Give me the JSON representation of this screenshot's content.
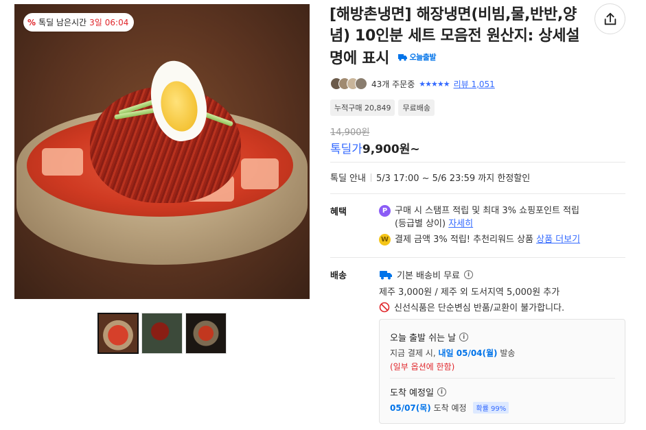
{
  "gallery": {
    "timer": {
      "label": "톡딜 남은시간",
      "days": "3일",
      "clock": "06:04"
    },
    "thumbnails": [
      "bibim-naengmyeon-bowl",
      "noodles-closeup",
      "naengmyeon-dark-bowl"
    ]
  },
  "product": {
    "title": "[해방촌냉면] 해장냉면(비빔,물,반반,양념) 10인분 세트 모음전 원산지: 상세설명에 표시",
    "today_badge": "오늘출발",
    "order_count": "43개 주문중",
    "stars": "★★★★★",
    "review_link": "리뷰 1,051",
    "tags": [
      "누적구매 20,849",
      "무료배송"
    ],
    "original_price": "14,900원",
    "sale_label": "톡딜가",
    "sale_price": "9,900원~"
  },
  "deal": {
    "label": "톡딜 안내",
    "period": "5/3 17:00 ~ 5/6 23:59 까지 한정할인"
  },
  "benefit": {
    "label": "혜택",
    "items": [
      {
        "text": "구매 시 스탬프 적립 및 최대 3% 쇼핑포인트 적립",
        "sub": "(등급별 상이)",
        "link": "자세히",
        "icon": "point-icon",
        "icon_glyph": "P",
        "color": "#8b5cf6"
      },
      {
        "text": "결제 금액 3% 적립! 추천리워드 상품",
        "link": "상품 더보기",
        "icon": "reward-coin-icon",
        "icon_glyph": "W",
        "color": "#f5c518"
      }
    ]
  },
  "shipping": {
    "label": "배송",
    "fee": "기본 배송비 무료",
    "extra": "제주 3,000원 / 제주 외 도서지역 5,000원 추가",
    "notice": "신선식품은 단순변심 반품/교환이 불가합니다.",
    "box": {
      "holiday_title": "오늘 출발 쉬는 날",
      "pay_prefix": "지금 결제 시,",
      "pay_date": "내일 05/04(월)",
      "pay_suffix": "발송",
      "note": "(일부 옵션에 한함)",
      "eta_title": "도착 예정일",
      "eta_date": "05/07(목)",
      "eta_suffix": "도착 예정",
      "probability": "확률 99%"
    }
  },
  "colors": {
    "accent": "#346aff",
    "sale_red": "#e0262b",
    "ship_blue": "#0073e9"
  }
}
